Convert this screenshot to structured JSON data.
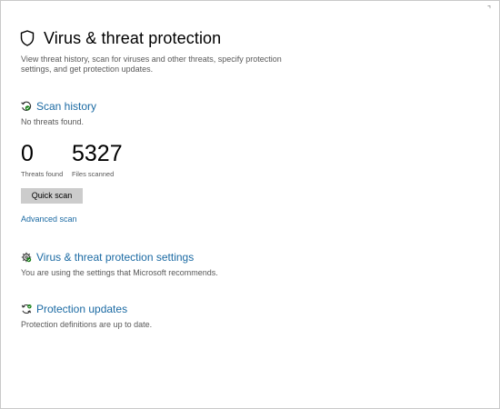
{
  "header": {
    "icon": "shield-icon",
    "title": "Virus & threat protection",
    "description": "View threat history, scan for viruses and other threats, specify protection settings, and get protection updates."
  },
  "scan_history": {
    "icon": "scan-history-icon",
    "title": "Scan history",
    "status": "No threats found.",
    "stats": [
      {
        "value": "0",
        "label": "Threats found"
      },
      {
        "value": "5327",
        "label": "Files scanned"
      }
    ],
    "quick_scan_label": "Quick scan",
    "advanced_scan_label": "Advanced scan"
  },
  "settings": {
    "icon": "settings-gear-icon",
    "title": "Virus & threat protection settings",
    "description": "You are using the settings that Microsoft recommends."
  },
  "updates": {
    "icon": "refresh-icon",
    "title": "Protection updates",
    "description": "Protection definitions are up to date."
  },
  "colors": {
    "link": "#1b6aa3",
    "body_text": "#595959",
    "button_bg": "#cccccc",
    "status_ok": "#107c10"
  }
}
